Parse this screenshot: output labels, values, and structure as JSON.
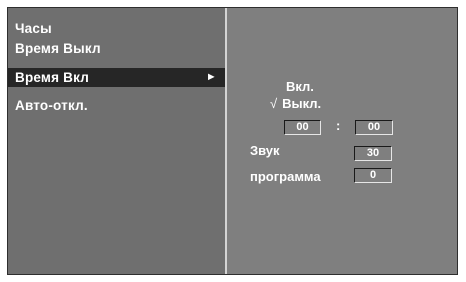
{
  "menu": {
    "items": [
      {
        "label": "Часы"
      },
      {
        "label": "Время Выкл"
      },
      {
        "label": "Время Вкл",
        "selected": true,
        "arrow": "►"
      },
      {
        "label": "Авто-откл."
      }
    ]
  },
  "timer_on": {
    "option_on_label": "Вкл.",
    "option_off_label": "Выкл.",
    "check_mark": "√",
    "selected_option": "Выкл.",
    "hour_value": "00",
    "time_separator": ":",
    "minute_value": "00",
    "volume_label": "Звук",
    "volume_value": "30",
    "program_label": "программа",
    "program_value": "0"
  },
  "colors": {
    "panel": "#7f7f7f",
    "left_panel": "#6f6f6f",
    "selected_row": "#262626",
    "text": "#ffffff"
  }
}
